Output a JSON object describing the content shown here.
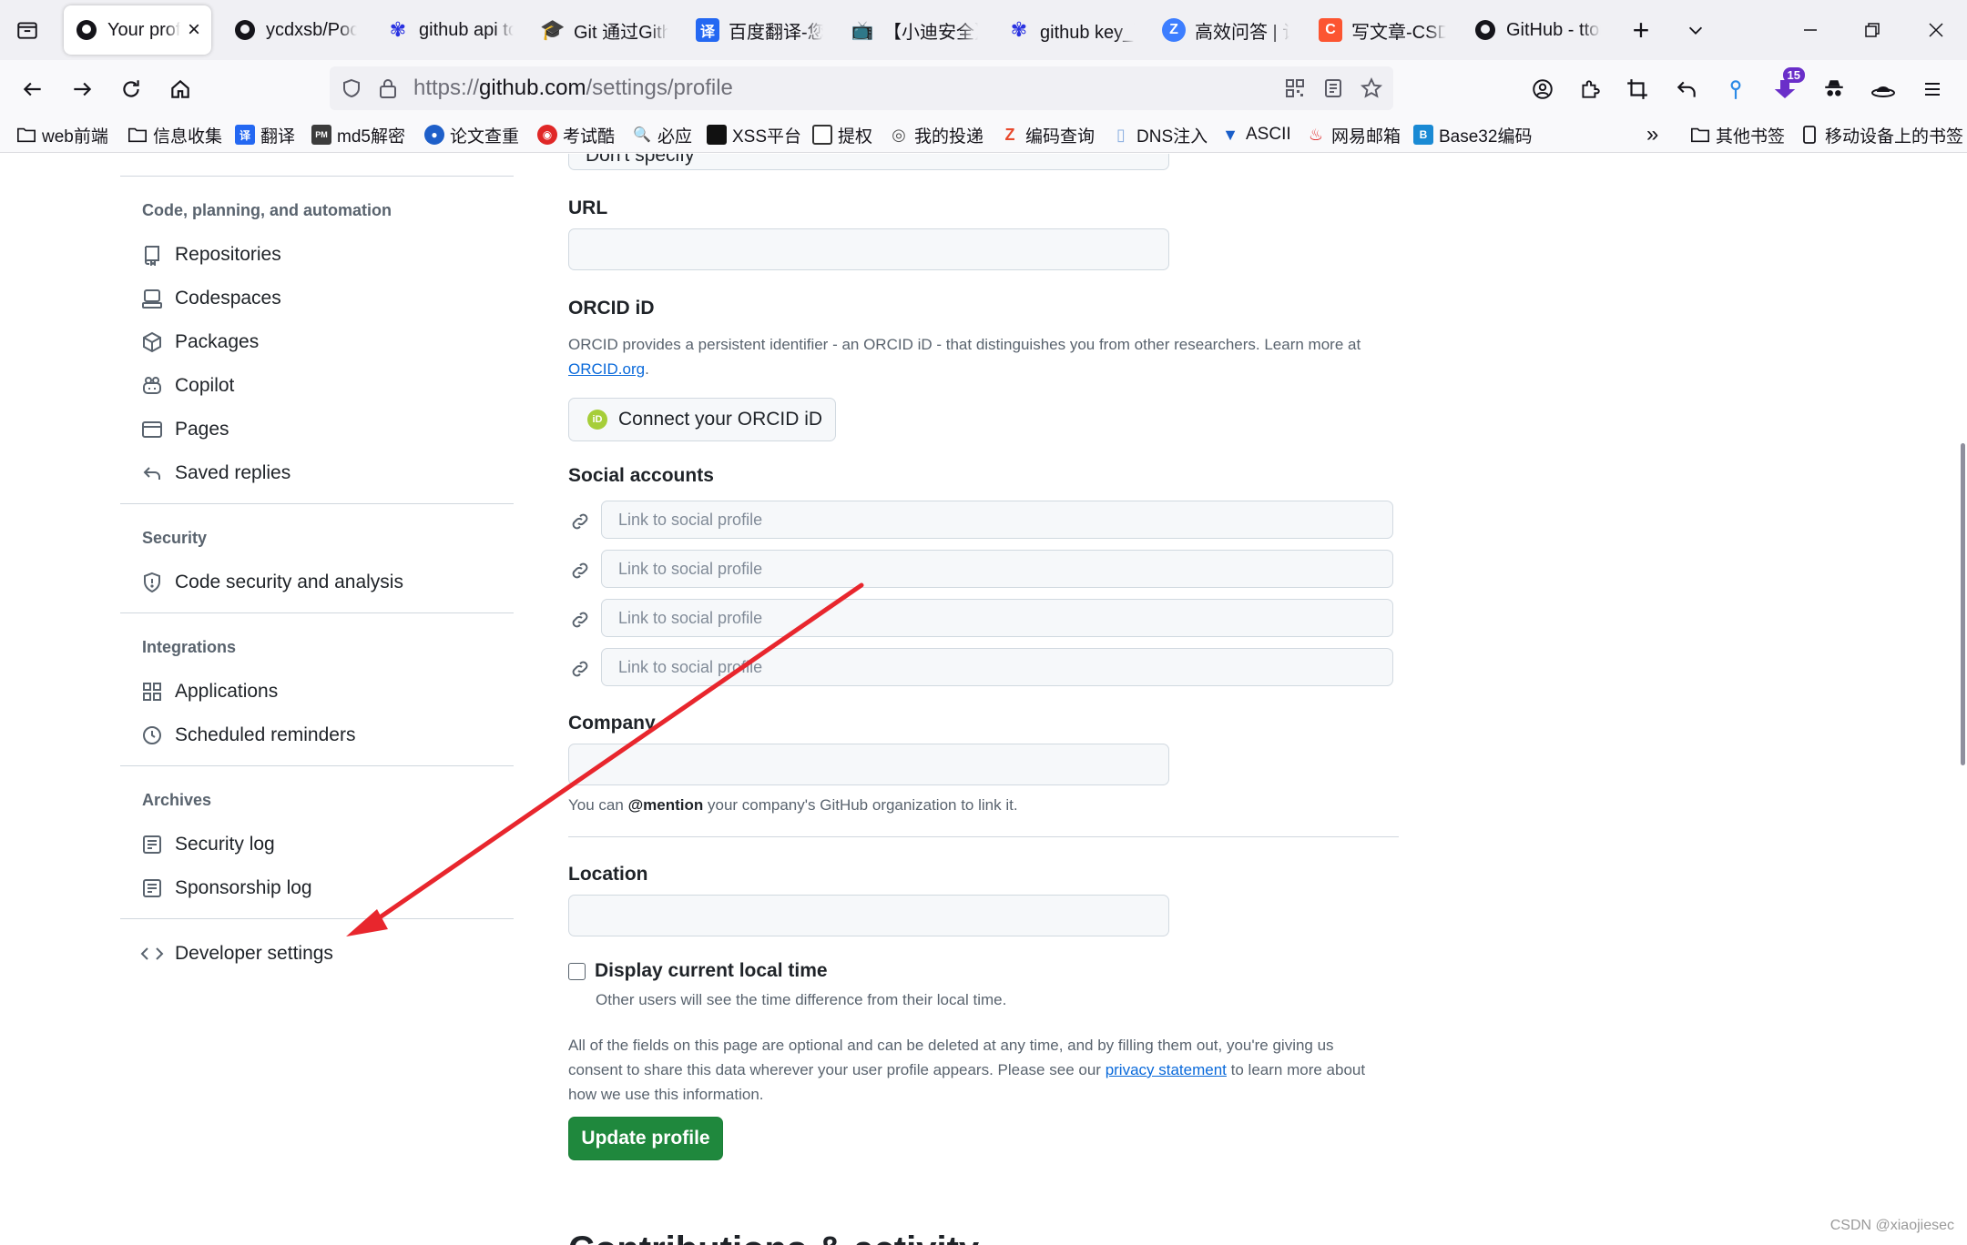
{
  "browser": {
    "tabs": [
      {
        "title": "Your profile",
        "active": true,
        "icon": "github-icon"
      },
      {
        "title": "ycdxsb/PocOrExp",
        "icon": "github-icon"
      },
      {
        "title": "github api token",
        "icon": "baidu-icon"
      },
      {
        "title": "Git 通过Github",
        "icon": "mortarboard-icon"
      },
      {
        "title": "百度翻译-您的",
        "icon": "translate-icon"
      },
      {
        "title": "【小迪安全】",
        "icon": "bilibili-icon"
      },
      {
        "title": "github key_百度",
        "icon": "baidu-icon"
      },
      {
        "title": "高效问答 | 让",
        "icon": "zhihu-icon"
      },
      {
        "title": "写文章-CSDN",
        "icon": "csdn-icon"
      },
      {
        "title": "GitHub - ttonys",
        "icon": "github-icon"
      }
    ],
    "url": {
      "dim_prefix": "https://",
      "domain": "github.com",
      "path": "/settings/profile"
    },
    "extension_badge": "15",
    "bookmarks": [
      "web前端",
      "信息收集",
      "翻译",
      "md5解密",
      "论文查重",
      "考试酷",
      "必应",
      "XSS平台",
      "提权",
      "我的投递",
      "编码查询",
      "DNS注入",
      "ASCII",
      "网易邮箱",
      "Base32编码"
    ],
    "bookmarks_right": [
      "其他书签",
      "移动设备上的书签"
    ]
  },
  "sidebar": {
    "groups": [
      {
        "heading": "Code, planning, and automation",
        "items": [
          "Repositories",
          "Codespaces",
          "Packages",
          "Copilot",
          "Pages",
          "Saved replies"
        ]
      },
      {
        "heading": "Security",
        "items": [
          "Code security and analysis"
        ]
      },
      {
        "heading": "Integrations",
        "items": [
          "Applications",
          "Scheduled reminders"
        ]
      },
      {
        "heading": "Archives",
        "items": [
          "Security log",
          "Sponsorship log"
        ]
      }
    ],
    "developer_settings": "Developer settings"
  },
  "form": {
    "pronouns_value": "Don't specify",
    "url_label": "URL",
    "orcid": {
      "label": "ORCID iD",
      "description": "ORCID provides a persistent identifier - an ORCID iD - that distinguishes you from other researchers. Learn more at",
      "link": "ORCID.org",
      "button": "Connect your ORCID iD"
    },
    "social": {
      "label": "Social accounts",
      "placeholder": "Link to social profile"
    },
    "company": {
      "label": "Company",
      "note_prefix": "You can",
      "note_mention": "@mention",
      "note_suffix": "your company's GitHub organization to link it."
    },
    "location_label": "Location",
    "local_time": {
      "label": "Display current local time",
      "note": "Other users will see the time difference from their local time."
    },
    "disclaimer": {
      "before": "All of the fields on this page are optional and can be deleted at any time, and by filling them out, you're giving us consent to share this data wherever your user profile appears. Please see our",
      "link": "privacy statement",
      "after": "to learn more about how we use this information."
    },
    "update_button": "Update profile",
    "next_heading": "Contributions & activity"
  },
  "watermark": "CSDN @xiaojiesec",
  "colors": {
    "primary_button": "#1f883d",
    "link": "#0969da",
    "annotation_arrow": "#e8262d"
  }
}
